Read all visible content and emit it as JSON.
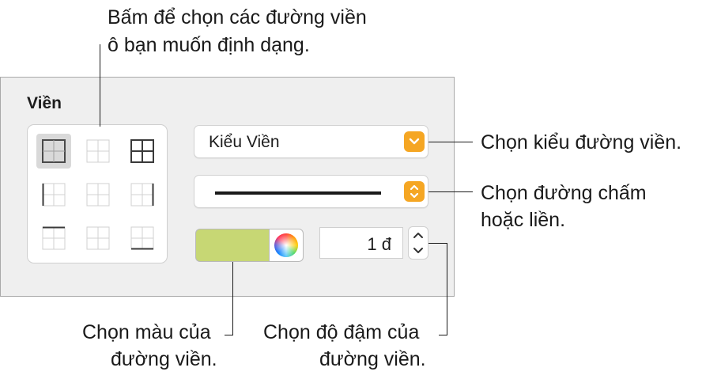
{
  "callouts": {
    "top_line1": "Bấm để chọn các đường viền",
    "top_line2": "ô bạn muốn định dạng.",
    "style_label": "Chọn kiểu đường viền.",
    "line_line1": "Chọn đường chấm",
    "line_line2": "hoặc liền.",
    "color_line1": "Chọn màu của",
    "color_line2": "đường viền.",
    "weight_line1": "Chọn độ đậm của",
    "weight_line2": "đường viền."
  },
  "panel": {
    "title": "Viền",
    "border_style_value": "Kiểu Viền",
    "line_type": "solid",
    "border_color": "#c7d774",
    "border_width": "1 đ",
    "accent_color": "#f5a623",
    "border_options": [
      "all-outer-and-inner-selected",
      "inside",
      "all",
      "left",
      "inside-vertical",
      "right",
      "top",
      "inside-horizontal",
      "bottom"
    ]
  }
}
